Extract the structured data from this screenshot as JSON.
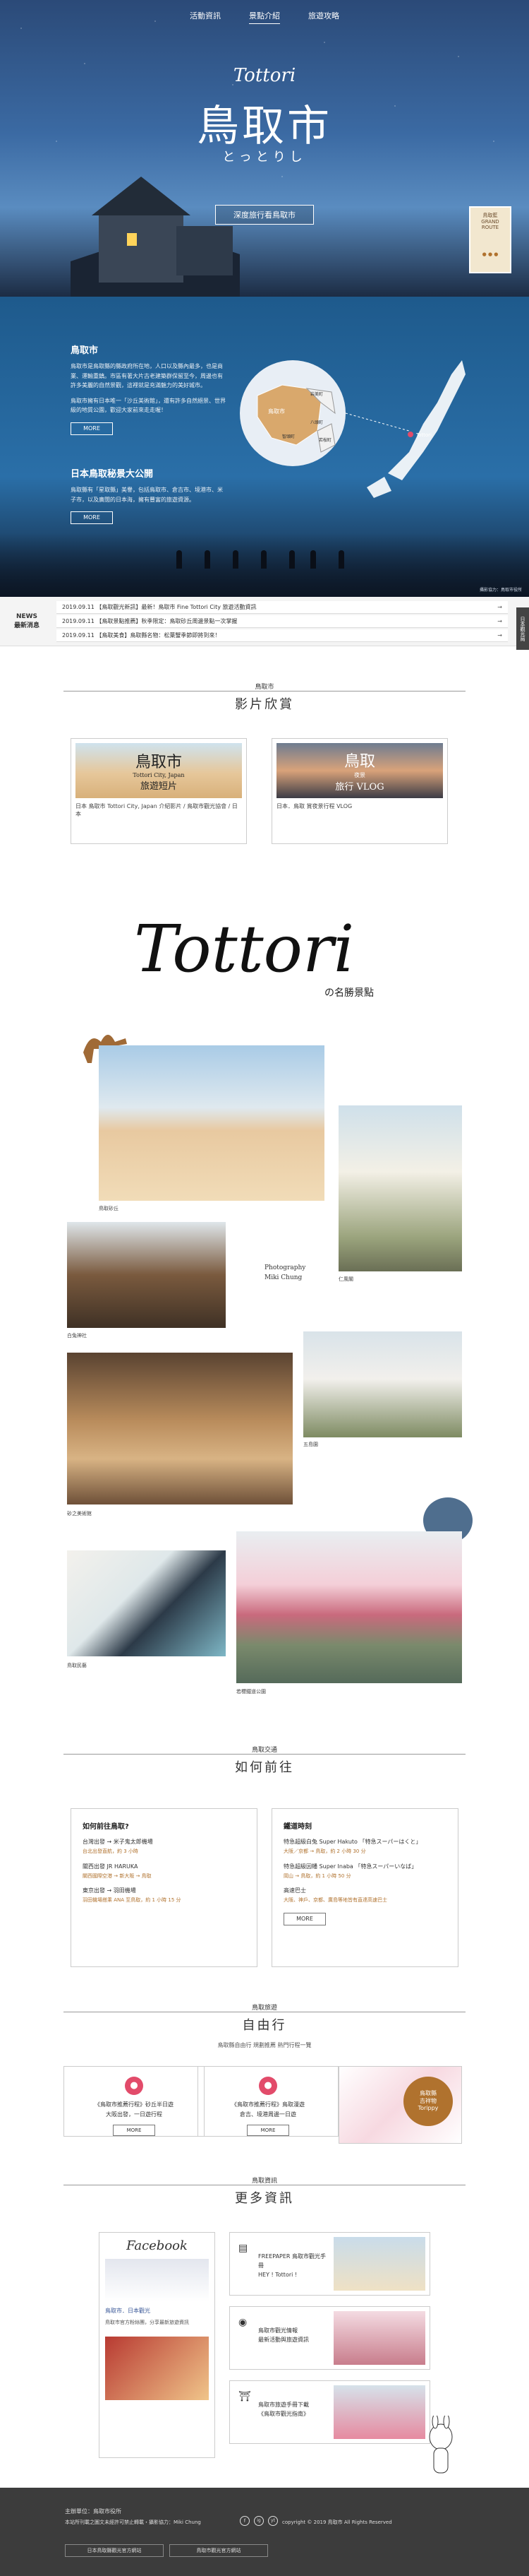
{
  "nav": {
    "items": [
      "活動資訊",
      "景點介紹",
      "旅遊攻略"
    ],
    "active": 1
  },
  "hero": {
    "title_en": "Tottori",
    "title_jp": "鳥取市",
    "subtitle": "とっとりし",
    "cta": "深度旅行看鳥取市",
    "side_card": "鳥取藍\nGRAND\nROUTE",
    "side_dots": "● ● ●"
  },
  "intro": {
    "h1": "鳥取市",
    "p1": "鳥取市是鳥取縣的縣政府所在地，人口以及縣內最多，也是商業、運輸重鎮。市區有著大片古老建築群保留至今，周邊也有許多美麗的自然景觀，這裡就是充滿魅力的美好城市。",
    "p1b": "鳥取市擁有日本唯一「沙丘美術館」，還有許多自然絕景、世界級的地質公園，歡迎大家前來走走喔！",
    "more1": "MORE",
    "h2": "日本鳥取秘景大公開",
    "p2": "鳥取縣有「星取縣」美譽，包括鳥取市、倉吉市、境港市、米子市，以及廣闊的日本海，擁有豐富的旅遊資源。",
    "more2": "MORE",
    "credit": "攝影協力：鳥取市役所",
    "map_labels": [
      "鳥取市",
      "岩美町",
      "八頭町",
      "若桜町",
      "智頭町"
    ],
    "map_pin": "Tottori"
  },
  "news": {
    "label": "NEWS\n最新消息",
    "rows": [
      {
        "date": "2019.09.11",
        "text": "【鳥取觀光新訊】最新！鳥取市 Fine Tottori City 旅遊活動資訊"
      },
      {
        "date": "2019.09.11",
        "text": "【鳥取景點推薦】秋季限定：鳥取砂丘周邊景點一次掌握"
      },
      {
        "date": "2019.09.11",
        "text": "【鳥取美食】鳥取縣名物：松葉蟹季節即將到來！"
      }
    ],
    "arrow": "→",
    "side_tab": "日本觀光局"
  },
  "video": {
    "small": "鳥取市",
    "big": "影片欣賞",
    "items": [
      {
        "title": "鳥取市",
        "sub": "Tottori City, Japan",
        "tag": "旅遊短片",
        "cap": "日本 鳥取市 Tottori City, Japan 介紹影片 / 鳥取市觀光協會 / 日本"
      },
      {
        "title": "鳥取",
        "sub": "夜景",
        "tag": "旅行 VLOG",
        "cap": "日本．鳥取 賞夜景行程 VLOG"
      }
    ]
  },
  "spots": {
    "script": "Tottori",
    "title": "の名勝景點",
    "credit": "Photography\nMiki Chung",
    "labels": [
      "鳥取砂丘",
      "仁風閣",
      "白兔神社",
      "五島園",
      "砂之美術館",
      "鳥取民藝",
      "若櫻鐵道公園"
    ]
  },
  "access": {
    "small": "鳥取交通",
    "big": "如何前往",
    "left": {
      "h": "如何前往鳥取?",
      "items": [
        {
          "t": "台灣出發 → 米子鬼太郎機場",
          "s": "台北出發直航，約 3 小時"
        },
        {
          "t": "關西出發 JR HARUKA",
          "s": "關西國際空港 → 新大阪 → 鳥取"
        },
        {
          "t": "東京出發 → 羽田機場",
          "s": "羽田機場搭乘 ANA 至鳥取，約 1 小時 15 分"
        }
      ],
      "more": "MORE"
    },
    "right": {
      "h": "鐵道時刻",
      "items": [
        {
          "t": "特急超級白兔 Super Hakuto 「特急スーパーはくと」",
          "s": "大阪／京都 → 鳥取，約 2 小時 30 分"
        },
        {
          "t": "特急超級因幡 Super Inaba 「特急スーパーいなば」",
          "s": "岡山 → 鳥取，約 1 小時 50 分"
        },
        {
          "t": "高速巴士",
          "s": "大阪、神戶、京都、廣島等地皆有直達高速巴士"
        }
      ],
      "more": "MORE"
    }
  },
  "tour": {
    "small": "鳥取旅遊",
    "big": "自由行",
    "desc": "鳥取縣自由行 規劃推薦 熱門行程一覽",
    "items": [
      {
        "t": "《鳥取市推薦行程》砂丘半日遊",
        "s": "大阪出發，一日遊行程",
        "btn": "MORE"
      },
      {
        "t": "《鳥取市推薦行程》鳥取漫遊",
        "s": "倉吉、境港周邊一日遊",
        "btn": "MORE"
      }
    ],
    "badge": "鳥取縣\n吉祥物\nTorippy"
  },
  "info": {
    "small": "鳥取資訊",
    "big": "更多資訊",
    "fb_title": "Facebook",
    "fb_page": "鳥取市．日本觀光",
    "fb_text": "鳥取市官方粉絲團，分享最新旅遊資訊",
    "items": [
      {
        "t": "FREEPAPER 鳥取市觀光手冊",
        "s": "HEY ! Tottori !"
      },
      {
        "t": "鳥取市觀光情報",
        "s": "最新活動與旅遊資訊"
      },
      {
        "t": "鳥取市旅遊手冊下載",
        "s": "《鳥取市觀光指南》"
      }
    ]
  },
  "footer": {
    "l1": "主辦單位：鳥取市役所",
    "l2": "本站所刊載之圖文未經許可禁止轉載・攝影協力：Miki Chung",
    "icons": [
      "f",
      "ig",
      "yt"
    ],
    "right": "copyright © 2019 鳥取市 All Rights Reserved",
    "b1": "日本鳥取縣觀光官方網站",
    "b2": "鳥取市觀光官方網站"
  },
  "colors": {
    "accent": "#b0722e",
    "night": "#2b4a78"
  }
}
